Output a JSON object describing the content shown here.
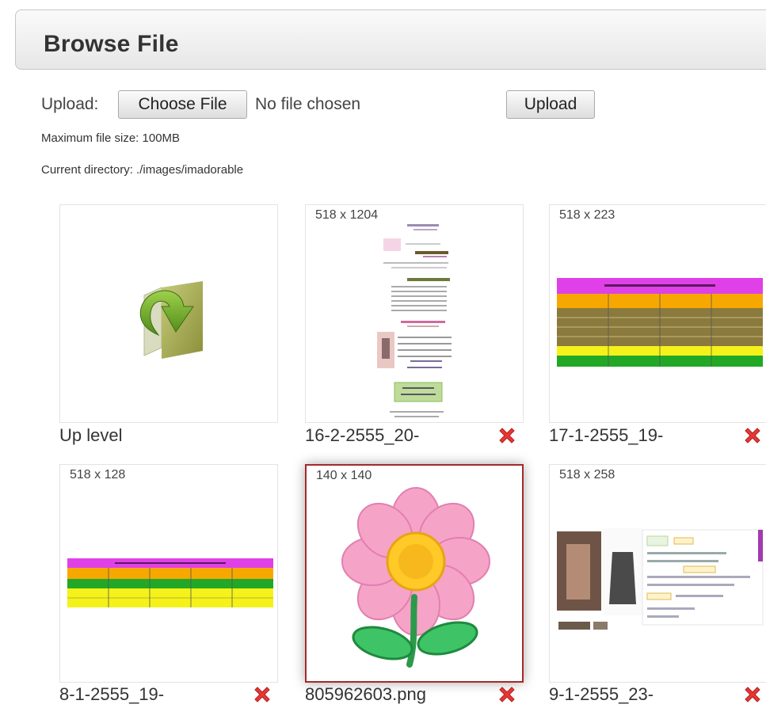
{
  "header": {
    "title": "Browse File"
  },
  "upload": {
    "label": "Upload:",
    "choose_button": "Choose File",
    "no_file_text": "No file chosen",
    "upload_button": "Upload",
    "max_size": "Maximum file size: 100MB",
    "current_directory": "Current directory: ./images/imadorable"
  },
  "items": [
    {
      "name": "Up level",
      "dims": "",
      "deletable": false
    },
    {
      "name": "16-2-2555_20-",
      "dims": "518 x 1204",
      "deletable": true
    },
    {
      "name": "17-1-2555_19-",
      "dims": "518 x 223",
      "deletable": true
    },
    {
      "name": "8-1-2555_19-",
      "dims": "518 x 128",
      "deletable": true
    },
    {
      "name": "805962603.png",
      "dims": "140 x 140",
      "deletable": true,
      "selected": true
    },
    {
      "name": "9-1-2555_23-",
      "dims": "518 x 258",
      "deletable": true
    }
  ],
  "colors": {
    "selected_border": "#a52a2a",
    "delete_icon": "#e53935",
    "folder_green": "#6aa22a"
  }
}
